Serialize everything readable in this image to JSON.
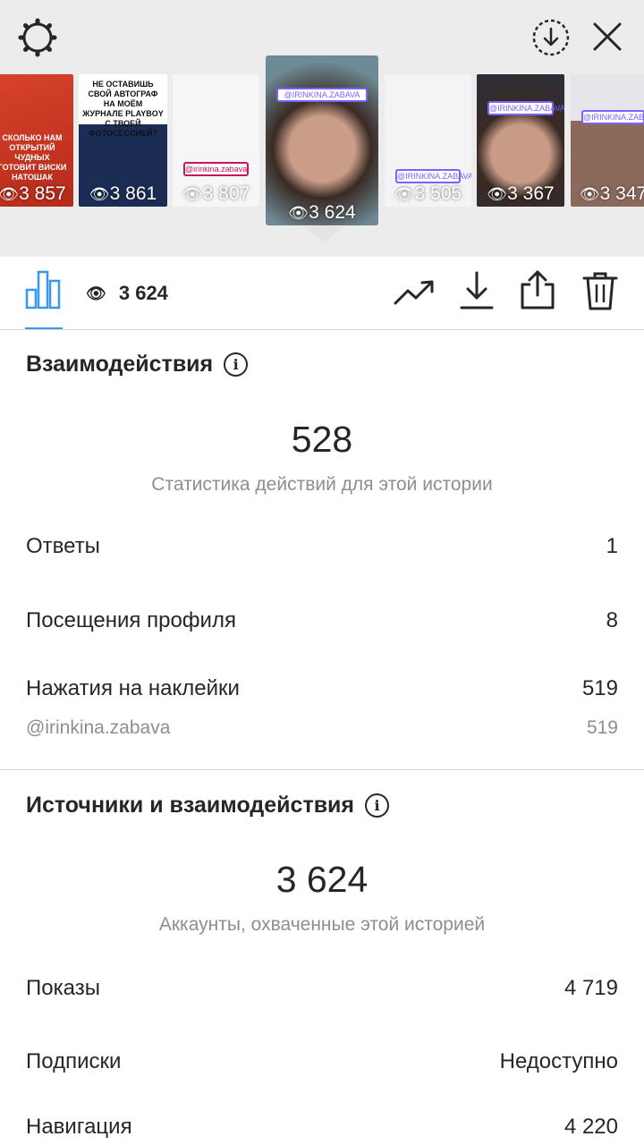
{
  "stories": [
    {
      "views": "3 857",
      "caption": "СКОЛЬКО НАМ ОТКРЫТИЙ ЧУДНЫХ ГОТОВИТ ВИСКИ НАТОШАК"
    },
    {
      "views": "3 861",
      "caption": "НЕ ОСТАВИШЬ СВОЙ АВТОГРАФ НА МОЁМ ЖУРНАЛЕ PLAYBOY С ТВОЕЙ ФОТОСЕССИЕЙ?"
    },
    {
      "views": "3 807",
      "caption": "@irinkina.zabava"
    },
    {
      "views": "3 624",
      "caption": "@IRINKINA.ZABAVA",
      "selected": true
    },
    {
      "views": "3 505",
      "caption": "@IRINKINA.ZABAVA"
    },
    {
      "views": "3 367",
      "caption": "@IRINKINA.ZABAVA"
    },
    {
      "views": "3 347",
      "caption": "@IRINKINA.ZABAVA"
    }
  ],
  "toolbar": {
    "views": "3 624"
  },
  "interactions": {
    "title": "Взаимодействия",
    "total": "528",
    "caption": "Статистика действий для этой истории",
    "rows": [
      {
        "label": "Ответы",
        "value": "1"
      },
      {
        "label": "Посещения профиля",
        "value": "8"
      },
      {
        "label": "Нажатия на наклейки",
        "value": "519"
      }
    ],
    "sub_row": {
      "label": "@irinkina.zabava",
      "value": "519"
    }
  },
  "discovery": {
    "title": "Источники и взаимодействия",
    "total": "3 624",
    "caption": "Аккаунты, охваченные этой историей",
    "rows": [
      {
        "label": "Показы",
        "value": "4 719"
      },
      {
        "label": "Подписки",
        "value": "Недоступно"
      },
      {
        "label": "Навигация",
        "value": "4 220"
      }
    ]
  },
  "colors": {
    "accent": "#3897f0",
    "text": "#262626",
    "muted": "#8e8e8e",
    "divider": "#dbdbdb",
    "strip_bg": "#ececec"
  }
}
